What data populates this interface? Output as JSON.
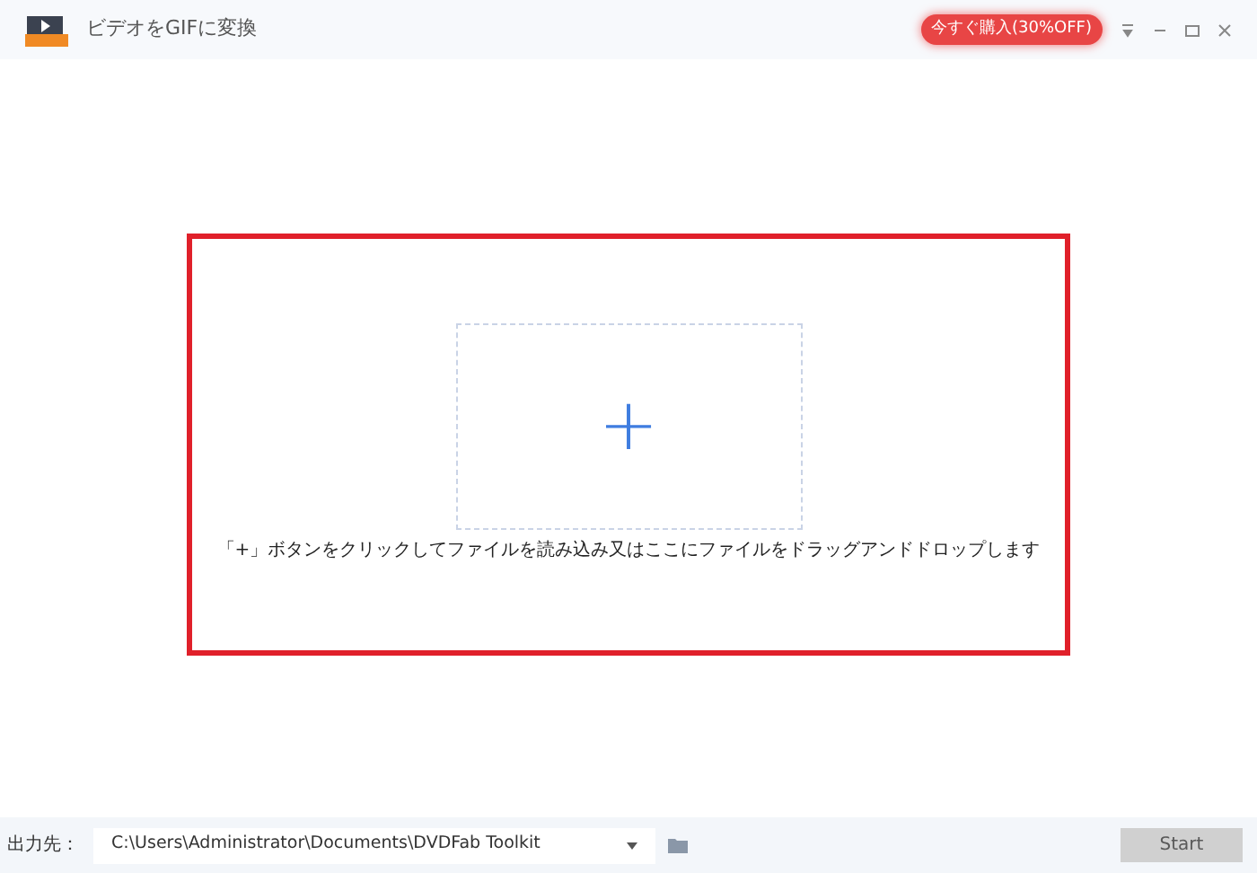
{
  "window": {
    "title": "ビデオをGIFに変換"
  },
  "promo_button": {
    "label": "今すぐ購入(30%OFF)"
  },
  "drop_area": {
    "add_symbol": "+",
    "hint": "「+」ボタンをクリックしてファイルを読み込み又はここにファイルをドラッグアンドドロップします",
    "highlighted": true
  },
  "output": {
    "label": "出力先：",
    "path": "C:\\Users\\Administrator\\Documents\\DVDFab Toolkit"
  },
  "start_button": {
    "label": "Start",
    "disabled": true
  }
}
